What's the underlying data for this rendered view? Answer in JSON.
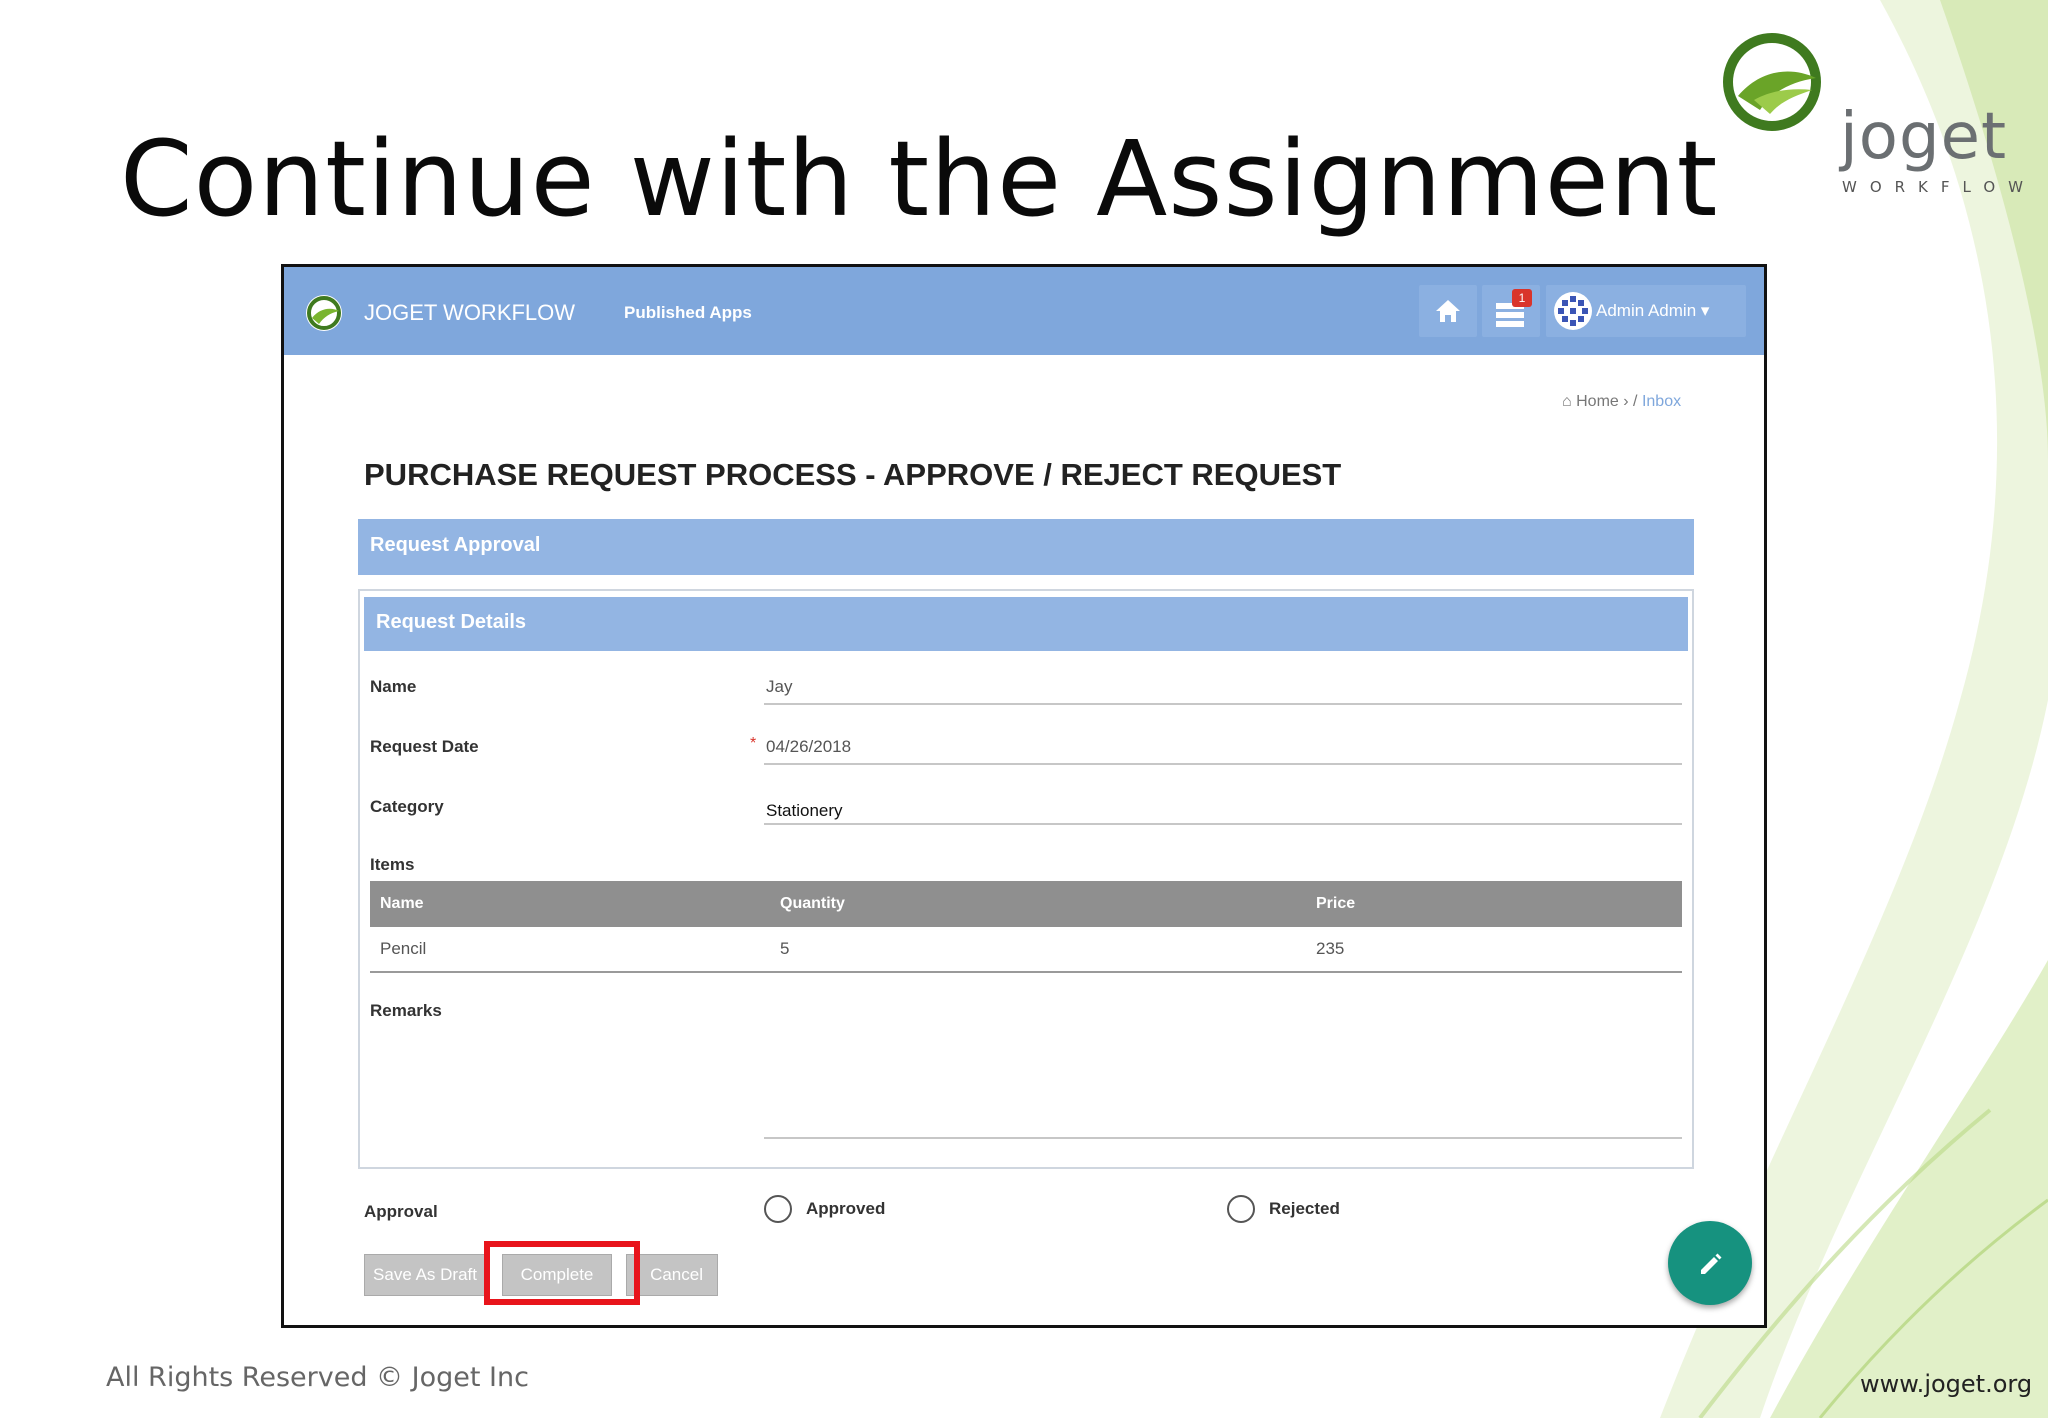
{
  "slide": {
    "title": "Continue with the Assignment",
    "brand_word": "joget",
    "brand_sub": "WORKFLOW",
    "footer_left": "All Rights Reserved © Joget Inc",
    "footer_right": "www.joget.org"
  },
  "app": {
    "header": {
      "app_name": "JOGET WORKFLOW",
      "published_apps": "Published Apps",
      "inbox_count": "1",
      "user_label": "Admin Admin"
    },
    "breadcrumb": {
      "home": "Home",
      "separator": "›",
      "slash": "/",
      "current": "Inbox"
    },
    "form": {
      "title": "PURCHASE REQUEST PROCESS - APPROVE / REJECT REQUEST",
      "section_approval": "Request Approval",
      "section_details": "Request Details",
      "fields": {
        "name_label": "Name",
        "name_value": "Jay",
        "date_label": "Request Date",
        "date_required": "*",
        "date_value": "04/26/2018",
        "category_label": "Category",
        "category_value": "Stationery",
        "items_label": "Items",
        "remarks_label": "Remarks"
      },
      "items_table": {
        "headers": [
          "Name",
          "Quantity",
          "Price"
        ],
        "rows": [
          [
            "Pencil",
            "5",
            "235"
          ]
        ]
      },
      "approval": {
        "label": "Approval",
        "option_approved": "Approved",
        "option_rejected": "Rejected"
      },
      "buttons": {
        "save_draft": "Save As Draft",
        "complete": "Complete",
        "cancel": "Cancel"
      }
    }
  },
  "colors": {
    "header": "#7fa7dc",
    "section": "#93b5e3",
    "table_header": "#8f8f8f",
    "highlight": "#e8141b",
    "fab": "#16927f"
  }
}
